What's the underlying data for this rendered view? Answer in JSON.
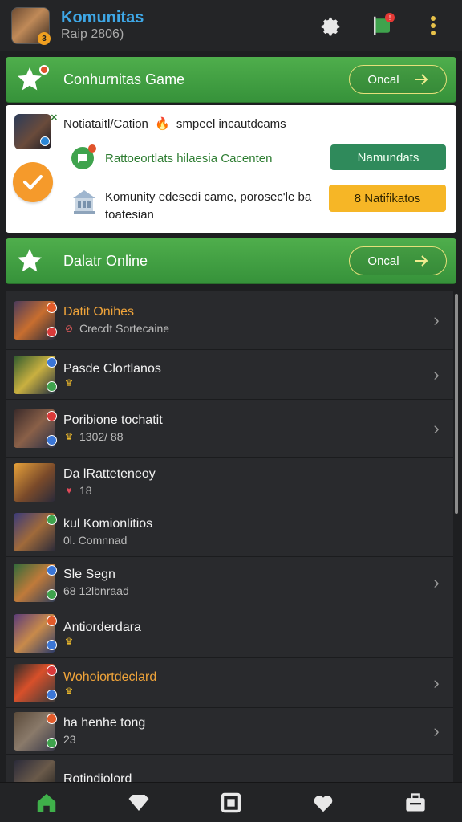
{
  "header": {
    "app_title": "Komunitas",
    "app_sub": "Raip 2806)",
    "avatar_badge": "3",
    "icons": [
      "settings-gear-icon",
      "flag-icon",
      "more-vert-icon"
    ],
    "flag_badge": "!"
  },
  "banner_top": {
    "title": "Conhurnitas Game",
    "button_label": "Oncal"
  },
  "notification": {
    "title_left": "Notiataitl/Cation",
    "title_right": "smpeel incautdcams",
    "row1_text": "Rattoeortlats hilaesia Cacenten",
    "row1_button": "Namundats",
    "row2_text": "Komunity edesedi came, porosec'le ba toatesian",
    "row2_button": "8 Natifikatos"
  },
  "banner_online": {
    "title": "Dalatr Online",
    "button_label": "Oncal"
  },
  "colors": {
    "accent_green": "#36923a",
    "accent_orange": "#f59a2b",
    "accent_blue": "#3ea7e6",
    "background": "#1e1f21"
  },
  "list": [
    {
      "name": "Datit Onihes",
      "sub": "Crecdt Sortecaine",
      "highlight": true,
      "chevron": true
    },
    {
      "name": "Pasde Clortlanos",
      "sub": "",
      "highlight": false,
      "chevron": true
    },
    {
      "name": "Poribione tochatit",
      "sub": "1302/ 88",
      "highlight": false,
      "chevron": true
    },
    {
      "name": "Da lRatteteneoy",
      "sub": "18",
      "highlight": false,
      "chevron": false
    },
    {
      "name": "kul Komionlitios",
      "sub": "0l. Comnnad",
      "highlight": false,
      "chevron": false
    },
    {
      "name": "Sle Segn",
      "sub": "68 12lbnraad",
      "highlight": false,
      "chevron": true
    },
    {
      "name": "Antiorderdara",
      "sub": "",
      "highlight": false,
      "chevron": false
    },
    {
      "name": "Wohoiortdeclard",
      "sub": "",
      "highlight": true,
      "chevron": true
    },
    {
      "name": "ha henhe tong",
      "sub": "23",
      "highlight": false,
      "chevron": true
    },
    {
      "name": "Rotindiolord",
      "sub": "",
      "highlight": false,
      "chevron": false
    }
  ],
  "bottom_nav": [
    "home-icon",
    "diamond-icon",
    "square-icon",
    "heart-icon",
    "toolbox-icon"
  ]
}
